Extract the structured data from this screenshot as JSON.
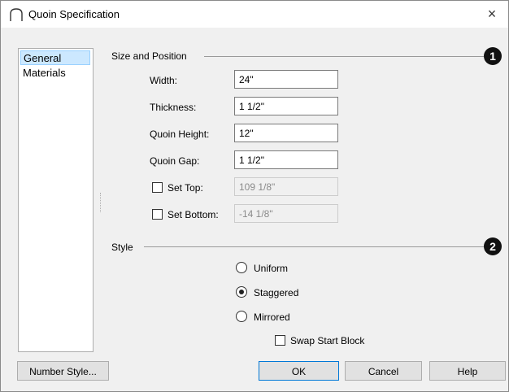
{
  "window": {
    "title": "Quoin Specification",
    "close_label": "×"
  },
  "nav": {
    "items": [
      "General",
      "Materials"
    ],
    "selected": "General"
  },
  "size_position": {
    "heading": "Size and Position",
    "callout": "1",
    "width": {
      "label": "Width:",
      "value": "24\""
    },
    "thickness": {
      "label": "Thickness:",
      "value": "1 1/2\""
    },
    "quoin_height": {
      "label": "Quoin Height:",
      "value": "12\""
    },
    "quoin_gap": {
      "label": "Quoin Gap:",
      "value": "1 1/2\""
    },
    "set_top": {
      "label": "Set Top:",
      "checked": false,
      "value": "109 1/8\""
    },
    "set_bottom": {
      "label": "Set Bottom:",
      "checked": false,
      "value": "-14 1/8\""
    }
  },
  "style": {
    "heading": "Style",
    "callout": "2",
    "options": [
      "Uniform",
      "Staggered",
      "Mirrored"
    ],
    "selected": "Staggered",
    "swap_start_block": {
      "label": "Swap Start Block",
      "checked": false
    }
  },
  "buttons": {
    "number_style": "Number Style...",
    "ok": "OK",
    "cancel": "Cancel",
    "help": "Help"
  }
}
